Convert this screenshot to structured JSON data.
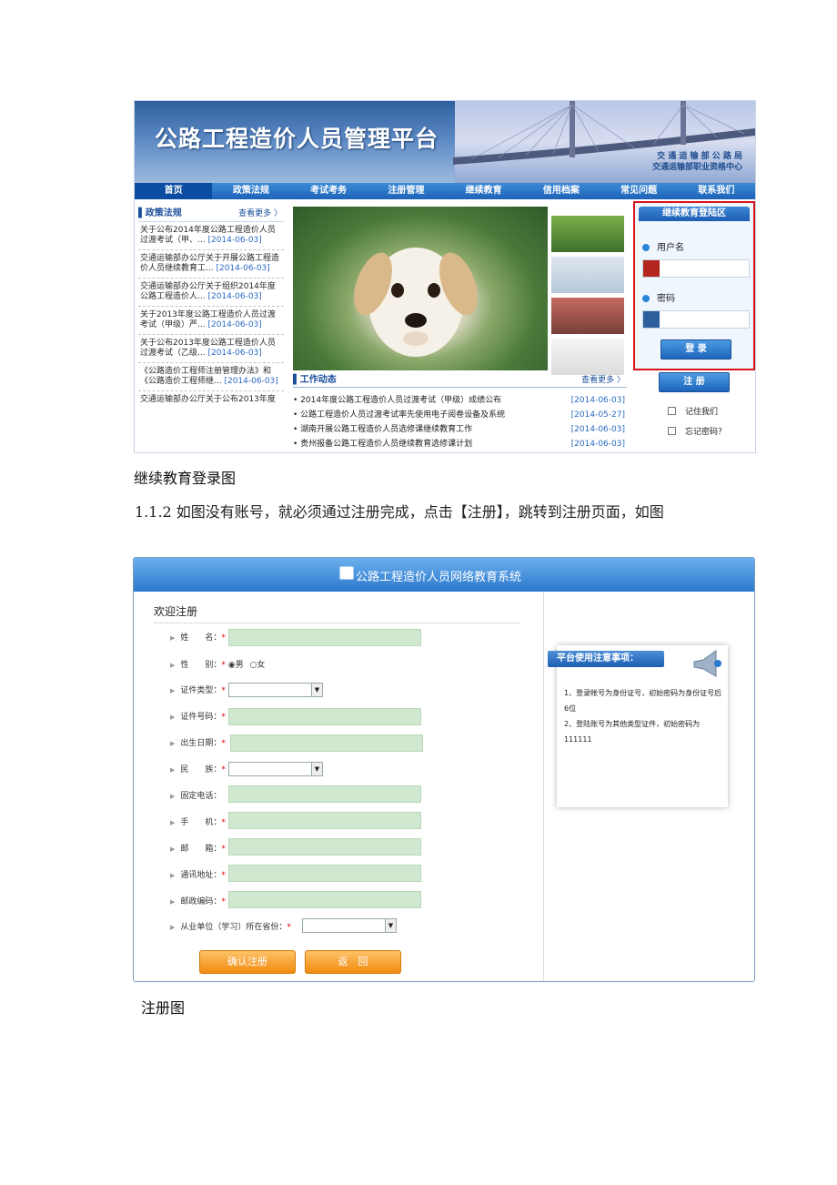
{
  "screenshot1": {
    "title": "公路工程造价人员管理平台",
    "org_line1": "交 通 运 输 部 公 路 局",
    "org_line2": "交通运输部职业资格中心",
    "nav": [
      "首页",
      "政策法规",
      "考试考务",
      "注册管理",
      "继续教育",
      "信用档案",
      "常见问题",
      "联系我们"
    ],
    "policy": {
      "heading": "政策法规",
      "more": "查看更多 〉",
      "items": [
        {
          "text": "关于公布2014年度公路工程造价人员过渡考试（甲、...",
          "date": "[2014-06-03]"
        },
        {
          "text": "交通运输部办公厅关于开展公路工程造价人员继续教育工...",
          "date": "[2014-06-03]"
        },
        {
          "text": "交通运输部办公厅关于组织2014年度公路工程造价人...",
          "date": "[2014-06-03]"
        },
        {
          "text": "关于2013年度公路工程造价人员过渡考试（甲级）严...",
          "date": "[2014-06-03]"
        },
        {
          "text": "关于公布2013年度公路工程造价人员过渡考试（乙级...",
          "date": "[2014-06-03]"
        },
        {
          "text": "《公路造价工程师注册管理办法》和《公路造价工程师继...",
          "date": "[2014-06-03]"
        },
        {
          "text": "交通运输部办公厅关于公布2013年度",
          "date": ""
        }
      ]
    },
    "news": {
      "heading": "工作动态",
      "more": "查看更多 〉",
      "items": [
        {
          "text": "• 2014年度公路工程造价人员过渡考试（甲级）成绩公布",
          "date": "[2014-06-03]"
        },
        {
          "text": "• 公路工程造价人员过渡考试率先使用电子阅卷设备及系统",
          "date": "[2014-05-27]"
        },
        {
          "text": "• 湖南开展公路工程造价人员选修课继续教育工作",
          "date": "[2014-06-03]"
        },
        {
          "text": "• 贵州报备公路工程造价人员继续教育选修课计划",
          "date": "[2014-06-03]"
        }
      ]
    },
    "login": {
      "heading": "继续教育登陆区",
      "username_label": "用户名",
      "password_label": "密码",
      "login_button": "登 录",
      "register_button": "注 册",
      "remember": "记住我们",
      "forgot": "忘记密码？"
    }
  },
  "caption1": "继续教育登录图",
  "paragraph": "1.1.2 如图没有账号，就必须通过注册完成，点击【注册】，跳转到注册页面，如图",
  "screenshot2": {
    "title": "公路工程造价人员网络教育系统",
    "welcome": "欢迎注册",
    "fields": {
      "name": "姓　　名：",
      "gender": "性　　别：",
      "male": "男",
      "female": "女",
      "id_type": "证件类型：",
      "id_number": "证件号码：",
      "birth": "出生日期：",
      "ethnic": "民　　族：",
      "phone": "固定电话：",
      "mobile": "手　　机：",
      "email": "邮　　箱：",
      "address": "通讯地址：",
      "postcode": "邮政编码：",
      "province": "从业单位（学习）所在省份："
    },
    "required_mark": "*",
    "confirm_button": "确认注册",
    "back_button": "返　回",
    "notice": {
      "title": "平台使用注意事项：",
      "line1": "1、登录帐号为身份证号，初始密码为身份证号后6位",
      "line2": "2、登陆账号为其他类型证件，初始密码为111111"
    }
  },
  "caption2": "注册图"
}
